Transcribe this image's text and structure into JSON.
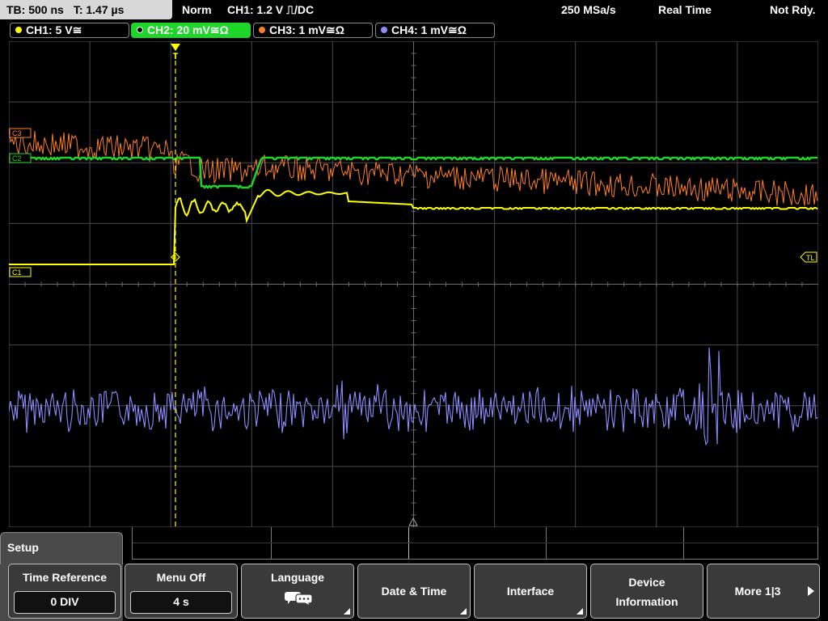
{
  "topbar": {
    "timebase": "TB: 500 ns",
    "trigger_time": "T: 1.47 µs",
    "mode": "Norm",
    "trigger": "CH1: 1.2 V ⎍/DC",
    "sample_rate": "250 MSa/s",
    "acq_mode": "Real Time",
    "status": "Not Rdy."
  },
  "channels": [
    {
      "label": "CH1: 5 V≅",
      "color": "#ffff00",
      "active": false
    },
    {
      "label": "CH2: 20 mV≅Ω",
      "color": "#1ed52a",
      "active": true
    },
    {
      "label": "CH3: 1 mV≅Ω",
      "color": "#ff7f27",
      "active": false
    },
    {
      "label": "CH4: 1 mV≅Ω",
      "color": "#8c8cff",
      "active": false
    }
  ],
  "markers": {
    "c3": "C3",
    "c2": "C2",
    "c1": "C1",
    "tl": "TL",
    "trigger_flag": "T"
  },
  "menu": {
    "title": "Setup",
    "time_reference": {
      "label": "Time Reference",
      "value": "0 DIV"
    },
    "menu_off": {
      "label": "Menu Off",
      "value": "4 s"
    },
    "language": {
      "label": "Language",
      "icon": "speech-bubbles-icon"
    },
    "date_time": {
      "label": "Date & Time"
    },
    "interface": {
      "label": "Interface"
    },
    "device_info": {
      "line1": "Device",
      "line2": "Information"
    },
    "more": {
      "label": "More 1|3"
    }
  },
  "colors": {
    "ch1": "#ffff00",
    "ch2": "#1ed52a",
    "ch3": "#ff7f27",
    "ch4": "#8c8cff",
    "grid": "#4a4a4a"
  }
}
